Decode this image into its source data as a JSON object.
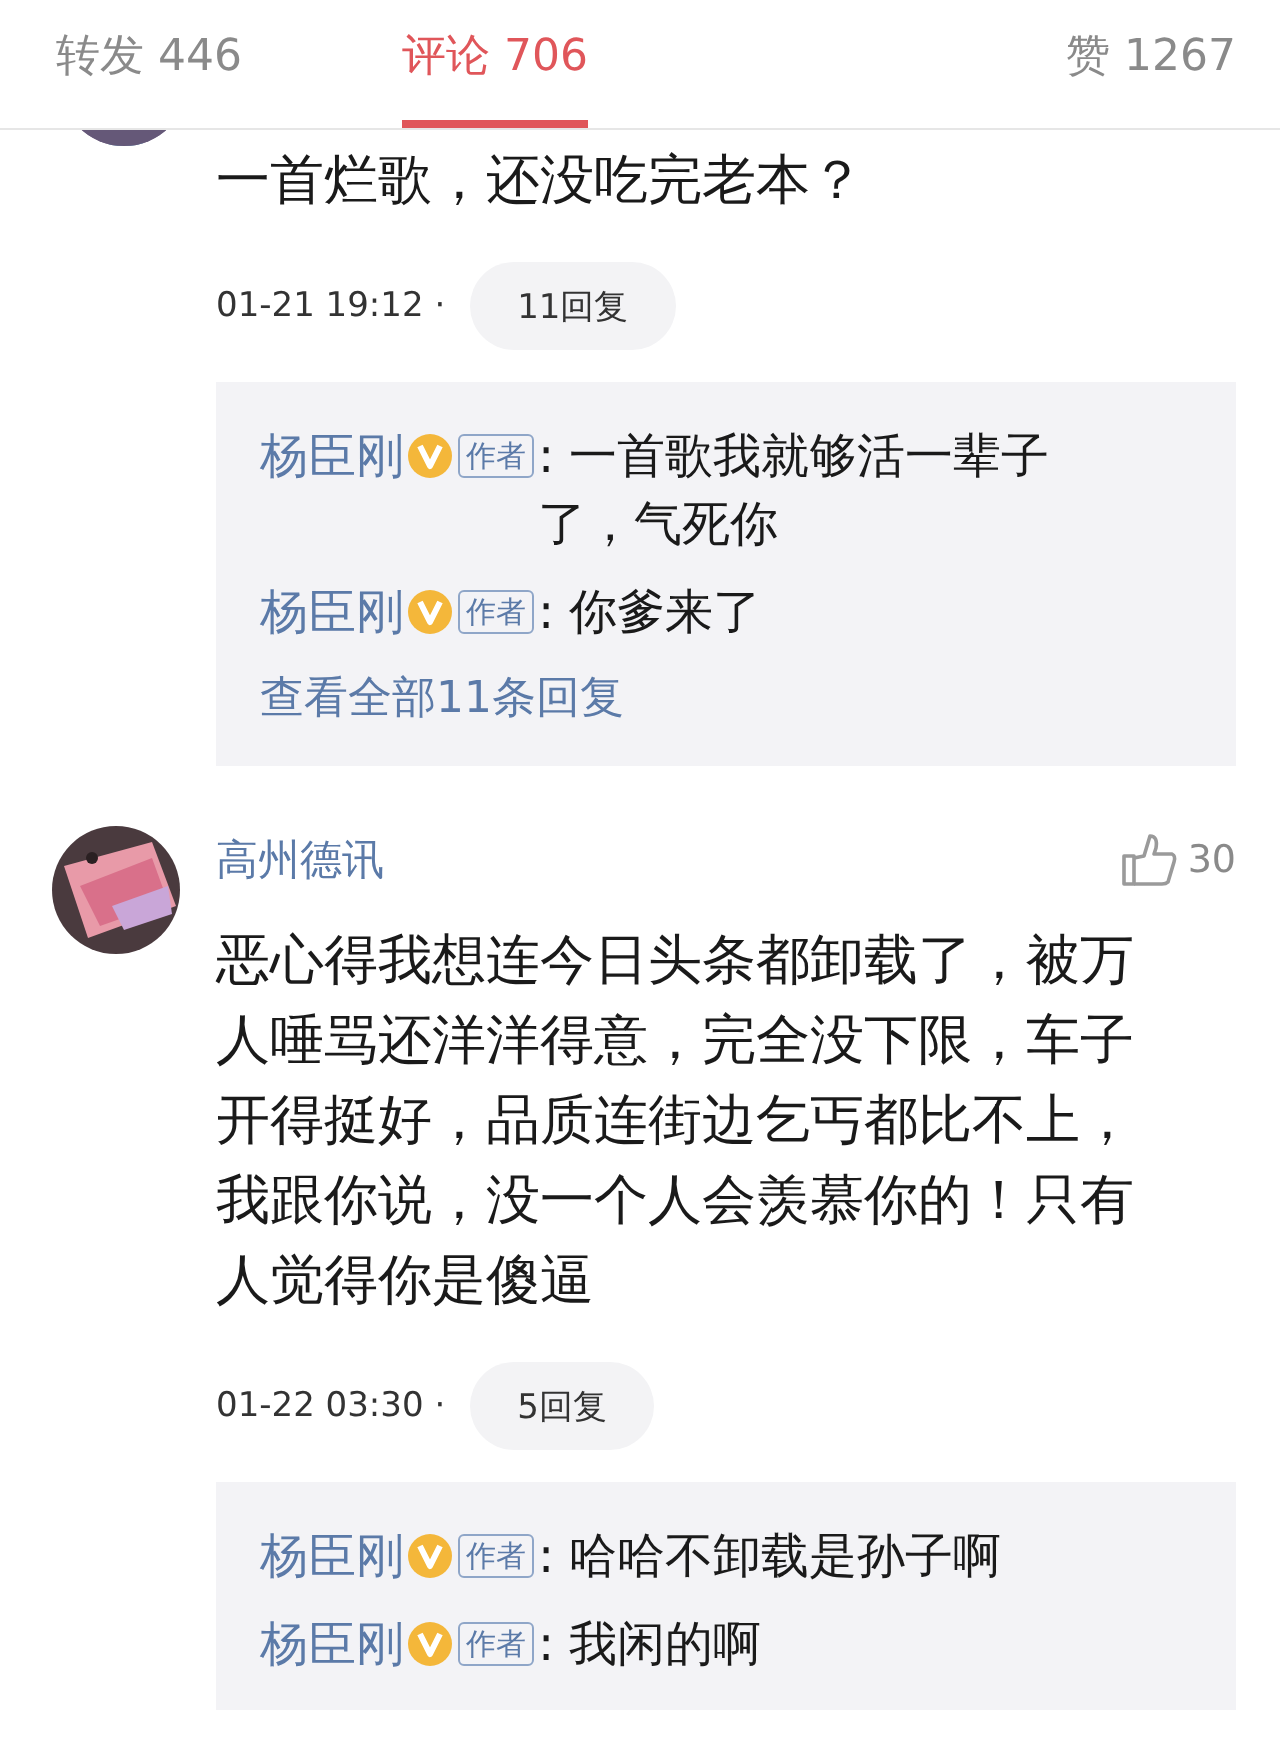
{
  "tabs": [
    {
      "label": "转发 446",
      "selected": false
    },
    {
      "label": "评论 706",
      "selected": true
    },
    {
      "label": "赞 1267",
      "selected": false
    }
  ],
  "comments": [
    {
      "avatar": {
        "kind": "picture"
      },
      "text": "一首烂歌，还没吃完老本？",
      "time": "01-21 19:12 ·",
      "reply_count": "11回复",
      "replies": [
        {
          "author": "杨臣刚",
          "verified": true,
          "badge": "作者",
          "text": ": 一首歌我就够活一辈子了，气死你"
        },
        {
          "author": "杨臣刚",
          "verified": true,
          "badge": "作者",
          "text": ": 你爹来了"
        }
      ],
      "view_all": "查看全部11条回复"
    },
    {
      "avatar": {
        "kind": "picture"
      },
      "author": "高州德讯",
      "likes": "30",
      "text": "恶心得我想连今日头条都卸载了，被万人唾骂还洋洋得意，完全没下限，车子开得挺好，品质连街边乞丐都比不上，我跟你说，没一个人会羡慕你的！只有人觉得你是傻逼",
      "time": "01-22 03:30 ·",
      "reply_count": "5回复",
      "replies": [
        {
          "author": "杨臣刚",
          "verified": true,
          "badge": "作者",
          "text": ": 哈哈不卸载是孙子啊"
        },
        {
          "author": "杨臣刚",
          "verified": true,
          "badge": "作者",
          "text": ": 我闲的啊"
        }
      ]
    }
  ]
}
